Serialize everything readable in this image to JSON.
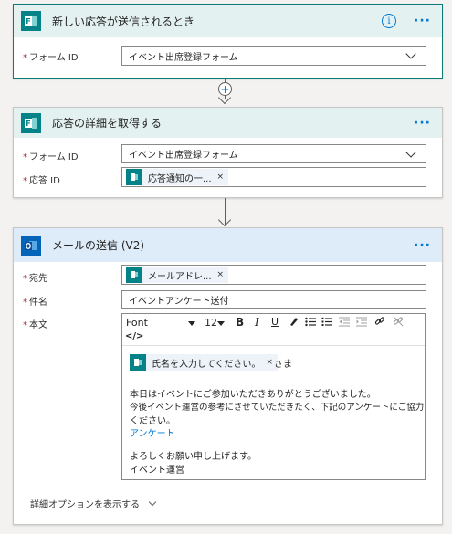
{
  "trigger": {
    "title": "新しい応答が送信されるとき",
    "info_icon": "info-icon",
    "more": "···",
    "form_id_label": "フォーム ID",
    "form_id_value": "イベント出席登録フォーム",
    "color": "#e3f2f1"
  },
  "get_details": {
    "title": "応答の詳細を取得する",
    "more": "···",
    "form_id_label": "フォーム ID",
    "form_id_value": "イベント出席登録フォーム",
    "response_id_label": "応答 ID",
    "response_id_token": "応答通知の一...",
    "token_close": "×"
  },
  "send_mail": {
    "title": "メールの送信 (V2)",
    "more": "···",
    "to_label": "宛先",
    "to_token": "メールアドレ...",
    "token_close": "×",
    "subject_label": "件名",
    "subject_value": "イベントアンケート送付",
    "body_label": "本文",
    "toolbar": {
      "font": "Font",
      "size": "12",
      "bold": "B",
      "italic": "I",
      "underline": "U",
      "code": "</>"
    },
    "body": {
      "name_token": "氏名を入力してください。",
      "suffix": "さま",
      "line1": "本日はイベントにご参加いただきありがとうございました。",
      "line2": "今後イベント運営の参考にさせていただきたく、下記のアンケートにご協力",
      "line3": "ください。",
      "link": "アンケート",
      "closing1": "よろしくお願い申し上げます。",
      "closing2": "イベント運営"
    },
    "advanced": "詳細オプションを表示する"
  },
  "required_mark": "*"
}
